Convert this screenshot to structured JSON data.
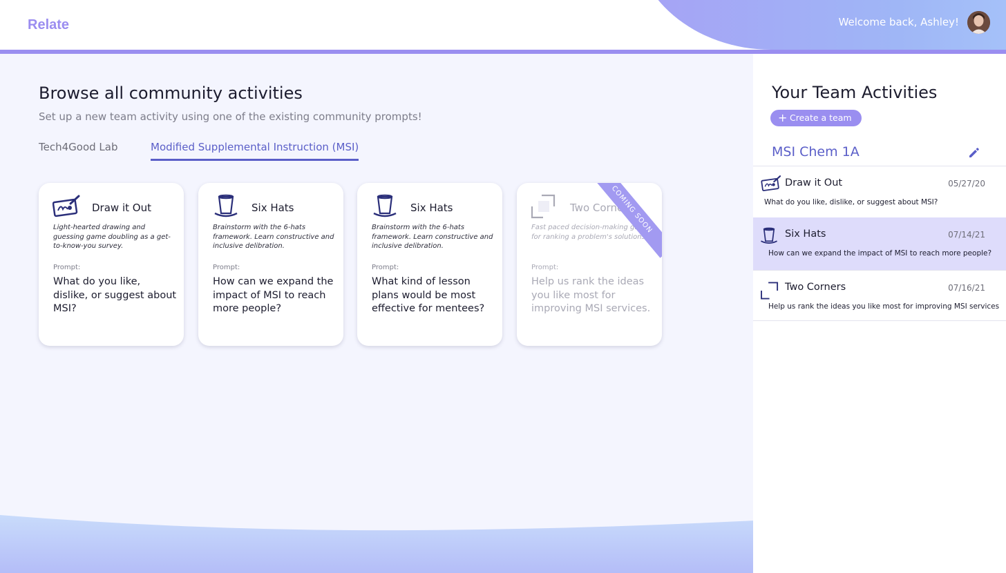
{
  "header": {
    "logo": "Relate",
    "welcome": "Welcome back, Ashley!"
  },
  "main": {
    "title": "Browse all community activities",
    "subtitle": "Set up a new team activity using one of the existing community prompts!",
    "tabs": [
      {
        "label": "Tech4Good Lab",
        "active": false
      },
      {
        "label": "Modified Supplemental Instruction (MSI)",
        "active": true
      }
    ],
    "cards": [
      {
        "icon": "drawing-icon",
        "name": "Draw it Out",
        "description": "Light-hearted drawing and guessing game doubling as a get-to-know-you survey.",
        "prompt_label": "Prompt:",
        "prompt": "What do you like, dislike, or suggest about MSI?"
      },
      {
        "icon": "top-hat-icon",
        "name": "Six Hats",
        "description": "Brainstorm with the 6-hats framework. Learn constructive and inclusive delibration.",
        "prompt_label": "Prompt:",
        "prompt": "How can we expand the impact of MSI to reach more people?"
      },
      {
        "icon": "top-hat-icon",
        "name": "Six Hats",
        "description": "Brainstorm with the 6-hats framework. Learn constructive and inclusive delibration.",
        "prompt_label": "Prompt:",
        "prompt": "What kind of lesson plans would be most effective for mentees?"
      },
      {
        "icon": "corners-icon",
        "name": "Two Corners",
        "description": "Fast paced decision-making game for ranking a problem's solutions.",
        "prompt_label": "Prompt:",
        "prompt": "Help us rank the ideas you like most for improving MSI services.",
        "ribbon": "COMING SOON"
      }
    ]
  },
  "sidebar": {
    "title": "Your Team Activities",
    "create_button": "Create a team",
    "team_name": "MSI Chem 1A",
    "activities": [
      {
        "icon": "drawing-icon",
        "name": "Draw it Out",
        "date": "05/27/20",
        "prompt": "What do you like, dislike, or suggest about MSI?",
        "selected": false
      },
      {
        "icon": "top-hat-icon",
        "name": "Six Hats",
        "date": "07/14/21",
        "prompt": "How can we expand the impact of MSI to reach more people?",
        "selected": true
      },
      {
        "icon": "corners-icon",
        "name": "Two Corners",
        "date": "07/16/21",
        "prompt": "Help us rank the ideas you like most for improving MSI services",
        "selected": false
      }
    ]
  },
  "colors": {
    "accent": "#9a8ef0",
    "active_tab": "#5a5ec8",
    "selected_row": "#dedcfb",
    "background": "#f4f5fe"
  }
}
